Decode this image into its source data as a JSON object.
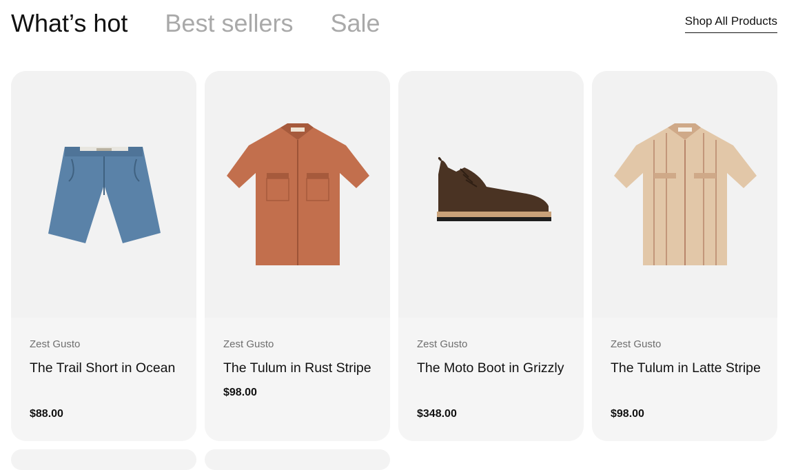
{
  "tabs": [
    {
      "label": "What’s hot",
      "active": true
    },
    {
      "label": "Best sellers",
      "active": false
    },
    {
      "label": "Sale",
      "active": false
    }
  ],
  "shop_all_label": "Shop All Products",
  "products": [
    {
      "brand": "Zest Gusto",
      "name": "The Trail Short in Ocean",
      "price": "$88.00",
      "image": "blue-shorts"
    },
    {
      "brand": "Zest Gusto",
      "name": "The Tulum in Rust Stripe",
      "price": "$98.00",
      "image": "rust-shirt"
    },
    {
      "brand": "Zest Gusto",
      "name": "The Moto Boot in Grizzly",
      "price": "$348.00",
      "image": "brown-boot"
    },
    {
      "brand": "Zest Gusto",
      "name": "The Tulum in Latte Stripe",
      "price": "$98.00",
      "image": "latte-shirt"
    }
  ],
  "colors": {
    "card_bg": "#f3f3f3",
    "tab_active": "#111111",
    "tab_inactive": "#a9a9a9",
    "shorts": "#5a82a8",
    "rust_shirt": "#c26f4d",
    "boot": "#4a3323",
    "latte_shirt": "#e2c7a8"
  }
}
